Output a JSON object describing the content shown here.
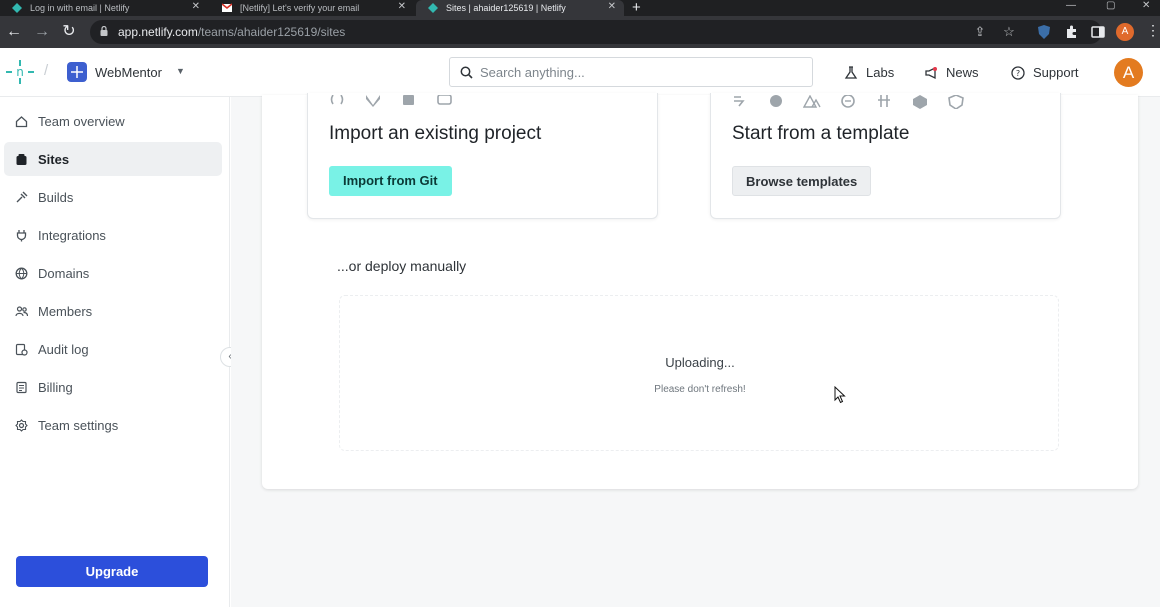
{
  "browser": {
    "tabs": [
      {
        "title": "Log in with email | Netlify",
        "active": false
      },
      {
        "title": "[Netlify] Let's verify your email",
        "active": false
      },
      {
        "title": "Sites | ahaider125619 | Netlify",
        "active": true
      }
    ],
    "url_host": "app.netlify.com",
    "url_path": "/teams/ahaider125619/sites",
    "profile_initial": "A"
  },
  "header": {
    "team_name": "WebMentor",
    "search_placeholder": "Search anything...",
    "links": [
      "Labs",
      "News",
      "Support"
    ],
    "avatar_initial": "A"
  },
  "sidebar": {
    "items": [
      {
        "label": "Team overview",
        "icon": "home-icon",
        "active": false
      },
      {
        "label": "Sites",
        "icon": "sites-icon",
        "active": true
      },
      {
        "label": "Builds",
        "icon": "builds-icon",
        "active": false
      },
      {
        "label": "Integrations",
        "icon": "plug-icon",
        "active": false
      },
      {
        "label": "Domains",
        "icon": "globe-icon",
        "active": false
      },
      {
        "label": "Members",
        "icon": "members-icon",
        "active": false
      },
      {
        "label": "Audit log",
        "icon": "audit-log-icon",
        "active": false
      },
      {
        "label": "Billing",
        "icon": "billing-icon",
        "active": false
      },
      {
        "label": "Team settings",
        "icon": "gear-icon",
        "active": false
      }
    ],
    "upgrade_label": "Upgrade"
  },
  "main": {
    "import_card": {
      "title": "Import an existing project",
      "button": "Import from Git"
    },
    "template_card": {
      "title": "Start from a template",
      "button": "Browse templates"
    },
    "manual_label": "...or deploy manually",
    "upload": {
      "status": "Uploading...",
      "note": "Please don't refresh!"
    }
  },
  "colors": {
    "accent_teal": "#79f2e6",
    "upgrade_blue": "#2c4fdb",
    "avatar_orange": "#e37b20"
  }
}
